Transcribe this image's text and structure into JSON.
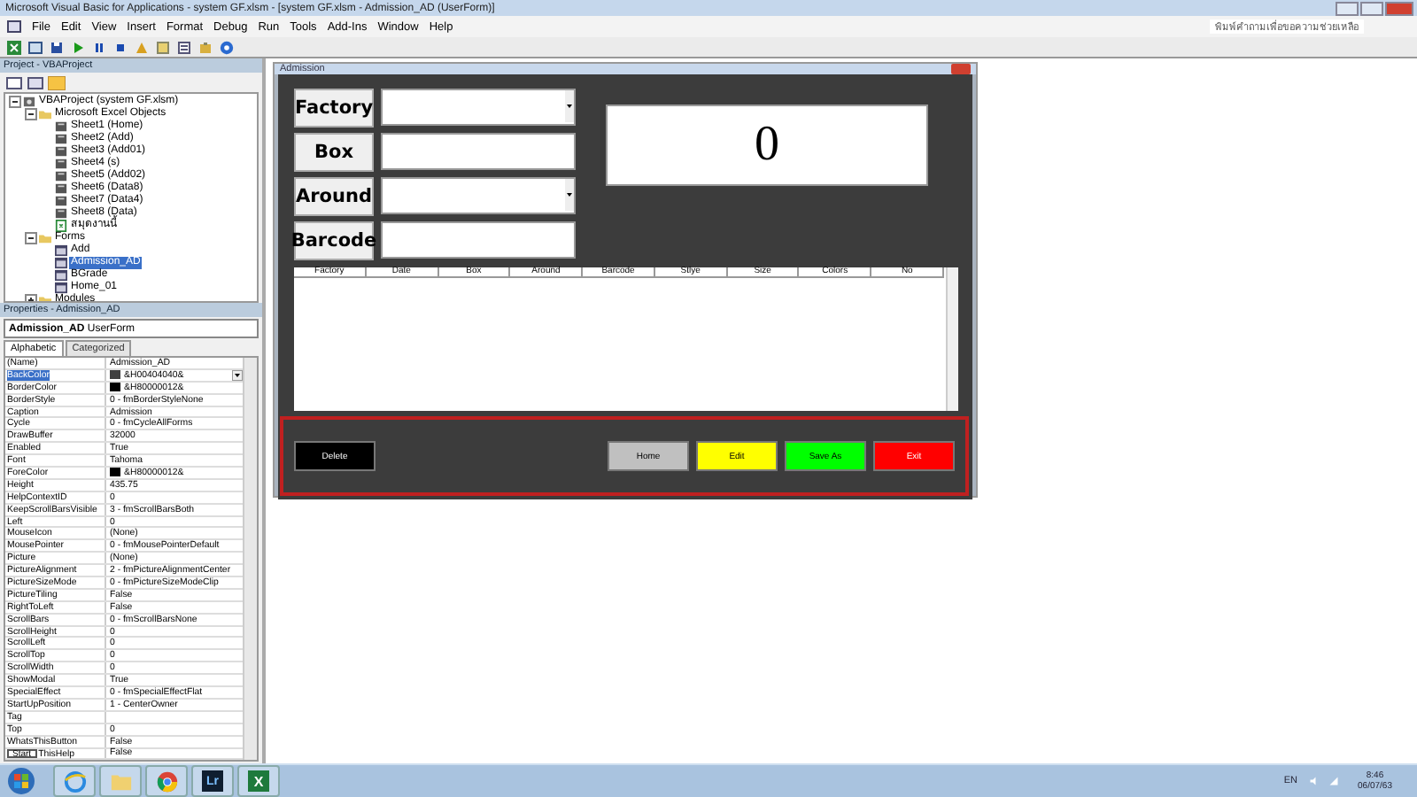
{
  "window": {
    "title": "Microsoft Visual Basic for Applications - system GF.xlsm - [system GF.xlsm - Admission_AD (UserForm)]"
  },
  "menu": [
    "File",
    "Edit",
    "View",
    "Insert",
    "Format",
    "Debug",
    "Run",
    "Tools",
    "Add-Ins",
    "Window",
    "Help"
  ],
  "help_box": {
    "placeholder": "พิมพ์คำถามเพื่อขอความช่วยเหลือ"
  },
  "project": {
    "title": "Project - VBAProject",
    "tree": [
      {
        "label": "VBAProject (system GF.xlsm)",
        "kind": "project",
        "expanded": true,
        "selected": false,
        "children": [
          {
            "label": "Microsoft Excel Objects",
            "kind": "folder",
            "expanded": true,
            "selected": false,
            "children": [
              {
                "label": "Sheet1 (Home)",
                "kind": "sheet",
                "selected": false
              },
              {
                "label": "Sheet2 (Add)",
                "kind": "sheet",
                "selected": false
              },
              {
                "label": "Sheet3 (Add01)",
                "kind": "sheet",
                "selected": false
              },
              {
                "label": "Sheet4 (s)",
                "kind": "sheet",
                "selected": false
              },
              {
                "label": "Sheet5 (Add02)",
                "kind": "sheet",
                "selected": false
              },
              {
                "label": "Sheet6 (Data8)",
                "kind": "sheet",
                "selected": false
              },
              {
                "label": "Sheet7 (Data4)",
                "kind": "sheet",
                "selected": false
              },
              {
                "label": "Sheet8 (Data)",
                "kind": "sheet",
                "selected": false
              },
              {
                "label": "สมุดงานนี้",
                "kind": "workbook",
                "selected": false
              }
            ]
          },
          {
            "label": "Forms",
            "kind": "folder",
            "expanded": true,
            "selected": false,
            "children": [
              {
                "label": "Add",
                "kind": "form",
                "selected": false
              },
              {
                "label": "Admission_AD",
                "kind": "form",
                "selected": true
              },
              {
                "label": "BGrade",
                "kind": "form",
                "selected": false
              },
              {
                "label": "Home_01",
                "kind": "form",
                "selected": false
              }
            ]
          },
          {
            "label": "Modules",
            "kind": "folder",
            "expanded": false,
            "selected": false
          }
        ]
      }
    ]
  },
  "properties": {
    "title": "Properties - Admission_AD",
    "object_name": "Admission_AD",
    "object_type": "UserForm",
    "tabs": [
      {
        "label": "Alphabetic",
        "selected": true
      },
      {
        "label": "Categorized",
        "selected": false
      }
    ],
    "rows": [
      {
        "name": "(Name)",
        "value": "Admission_AD",
        "selected": false
      },
      {
        "name": "BackColor",
        "value": "&H00404040&",
        "color": "#404040",
        "selected": true
      },
      {
        "name": "BorderColor",
        "value": "&H80000012&",
        "color": "#000000",
        "selected": false
      },
      {
        "name": "BorderStyle",
        "value": "0 - fmBorderStyleNone",
        "selected": false
      },
      {
        "name": "Caption",
        "value": "Admission",
        "selected": false
      },
      {
        "name": "Cycle",
        "value": "0 - fmCycleAllForms",
        "selected": false
      },
      {
        "name": "DrawBuffer",
        "value": "32000",
        "selected": false
      },
      {
        "name": "Enabled",
        "value": "True",
        "selected": false
      },
      {
        "name": "Font",
        "value": "Tahoma",
        "selected": false
      },
      {
        "name": "ForeColor",
        "value": "&H80000012&",
        "color": "#000000",
        "selected": false
      },
      {
        "name": "Height",
        "value": "435.75",
        "selected": false
      },
      {
        "name": "HelpContextID",
        "value": "0",
        "selected": false
      },
      {
        "name": "KeepScrollBarsVisible",
        "value": "3 - fmScrollBarsBoth",
        "selected": false
      },
      {
        "name": "Left",
        "value": "0",
        "selected": false
      },
      {
        "name": "MouseIcon",
        "value": "(None)",
        "selected": false
      },
      {
        "name": "MousePointer",
        "value": "0 - fmMousePointerDefault",
        "selected": false
      },
      {
        "name": "Picture",
        "value": "(None)",
        "selected": false
      },
      {
        "name": "PictureAlignment",
        "value": "2 - fmPictureAlignmentCenter",
        "selected": false
      },
      {
        "name": "PictureSizeMode",
        "value": "0 - fmPictureSizeModeClip",
        "selected": false
      },
      {
        "name": "PictureTiling",
        "value": "False",
        "selected": false
      },
      {
        "name": "RightToLeft",
        "value": "False",
        "selected": false
      },
      {
        "name": "ScrollBars",
        "value": "0 - fmScrollBarsNone",
        "selected": false
      },
      {
        "name": "ScrollHeight",
        "value": "0",
        "selected": false
      },
      {
        "name": "ScrollLeft",
        "value": "0",
        "selected": false
      },
      {
        "name": "ScrollTop",
        "value": "0",
        "selected": false
      },
      {
        "name": "ScrollWidth",
        "value": "0",
        "selected": false
      },
      {
        "name": "ShowModal",
        "value": "True",
        "selected": false
      },
      {
        "name": "SpecialEffect",
        "value": "0 - fmSpecialEffectFlat",
        "selected": false
      },
      {
        "name": "StartUpPosition",
        "value": "1 - CenterOwner",
        "selected": false
      },
      {
        "name": "Tag",
        "value": "",
        "selected": false
      },
      {
        "name": "Top",
        "value": "0",
        "selected": false
      },
      {
        "name": "WhatsThisButton",
        "value": "False",
        "selected": false
      },
      {
        "name": "ThisHelp",
        "tooltip": "Start",
        "value": "False",
        "selected": false
      }
    ]
  },
  "form": {
    "title": "Admission",
    "fields": [
      {
        "label": "Factory",
        "kind": "combo"
      },
      {
        "label": "Box",
        "kind": "text"
      },
      {
        "label": "Around",
        "kind": "combo"
      },
      {
        "label": "Barcode",
        "kind": "text"
      }
    ],
    "counter": "0",
    "list_columns": [
      "Factory",
      "Date",
      "Box",
      "Around",
      "Barcode",
      "Stlye",
      "Size",
      "Colors",
      "No"
    ],
    "buttons": [
      {
        "label": "Delete",
        "color": "#000000"
      },
      {
        "label": "Home",
        "color": "#c0c0c0"
      },
      {
        "label": "Edit",
        "color": "#ffff00"
      },
      {
        "label": "Save As",
        "color": "#00ff00"
      },
      {
        "label": "Exit",
        "color": "#ff0000"
      }
    ]
  },
  "taskbar": {
    "apps": [
      {
        "kind": "ie"
      },
      {
        "kind": "folder"
      },
      {
        "kind": "chrome"
      },
      {
        "kind": "lr",
        "label": "Lr"
      },
      {
        "kind": "excel",
        "label": "X"
      }
    ],
    "language": "EN",
    "time": "8:46",
    "date": "06/07/63"
  }
}
